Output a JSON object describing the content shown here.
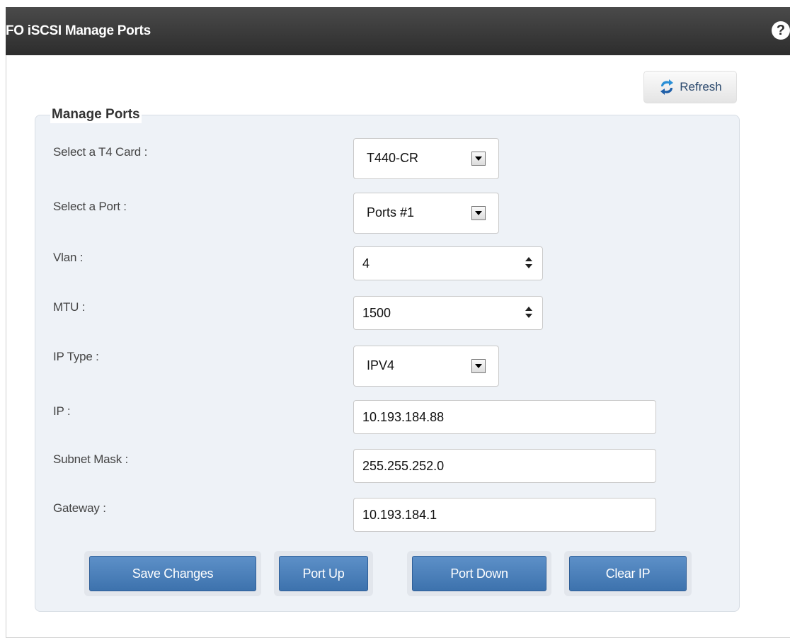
{
  "window": {
    "title": "FO iSCSI Manage Ports",
    "help_label": "?"
  },
  "toolbar": {
    "refresh_label": "Refresh"
  },
  "form": {
    "legend": "Manage Ports",
    "card": {
      "label": "Select a T4 Card :",
      "value": "T440-CR"
    },
    "port": {
      "label": "Select a Port :",
      "value": "Ports #1"
    },
    "vlan": {
      "label": "Vlan :",
      "value": "4"
    },
    "mtu": {
      "label": "MTU :",
      "value": "1500"
    },
    "ip_type": {
      "label": "IP Type :",
      "value": "IPV4"
    },
    "ip": {
      "label": "IP :",
      "value": "10.193.184.88"
    },
    "subnet": {
      "label": "Subnet Mask :",
      "value": "255.255.252.0"
    },
    "gateway": {
      "label": "Gateway :",
      "value": "10.193.184.1"
    }
  },
  "buttons": {
    "save": "Save Changes",
    "port_up": "Port Up",
    "port_down": "Port Down",
    "clear_ip": "Clear IP"
  },
  "colors": {
    "titlebar": "#333333",
    "button": "#4a80bd",
    "panel": "#eef2f7"
  }
}
